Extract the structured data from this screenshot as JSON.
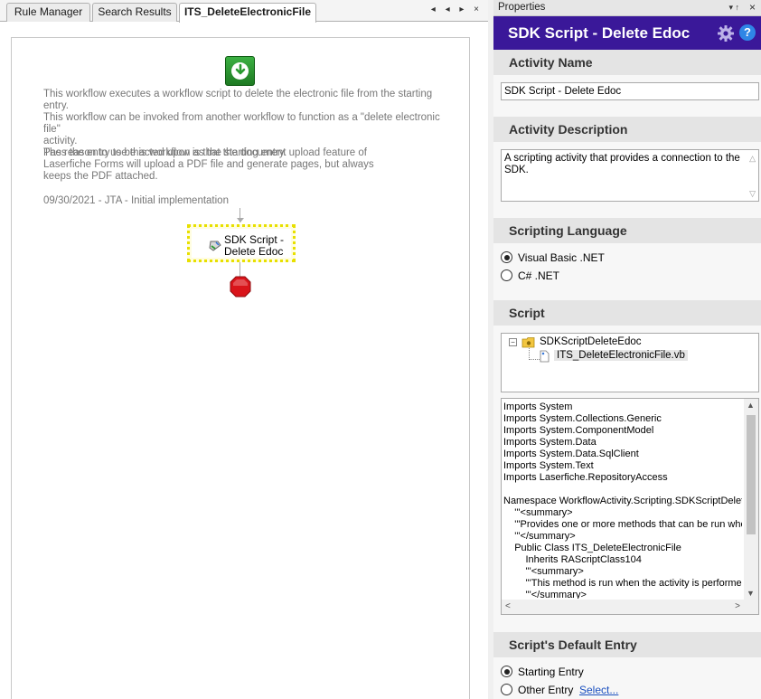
{
  "tabs": [
    {
      "label": "Rule Manager",
      "active": false
    },
    {
      "label": "Search Results",
      "active": false
    },
    {
      "label": "ITS_DeleteElectronicFile",
      "active": true
    }
  ],
  "tab_controls": "◂ ◂ ▸ ×",
  "workflow": {
    "description_1": "This workflow executes a workflow script to delete the electronic file from the starting entry.\nThis workflow can be invoked from another workflow to function as a \"delete electronic file\"\nactivity.\nPass the entry to be acted upon as the starting entry.",
    "description_2": "The reason to use this workflow is that the document upload feature of\nLaserfiche Forms will upload a PDF file and generate pages, but always\nkeeps the PDF attached.",
    "description_3": "09/30/2021 - JTA - Initial implementation",
    "activity_label": "SDK Script -\nDelete Edoc"
  },
  "properties": {
    "panel_title": "Properties",
    "pin_glyph": "▾ ↑",
    "close_glyph": "×",
    "heading": "SDK Script - Delete Edoc",
    "help_glyph": "?",
    "activity_name": {
      "header": "Activity Name",
      "value": "SDK Script - Delete Edoc"
    },
    "activity_description": {
      "header": "Activity Description",
      "value": "A scripting activity that provides a connection to the SDK."
    },
    "scripting_language": {
      "header": "Scripting Language",
      "options": [
        {
          "label": "Visual Basic .NET",
          "selected": true
        },
        {
          "label": "C# .NET",
          "selected": false
        }
      ]
    },
    "script": {
      "header": "Script",
      "tree_root": "SDKScriptDeleteEdoc",
      "tree_child": "ITS_DeleteElectronicFile.vb",
      "code_lines": [
        "Imports System",
        "Imports System.Collections.Generic",
        "Imports System.ComponentModel",
        "Imports System.Data",
        "Imports System.Data.SqlClient",
        "Imports System.Text",
        "Imports Laserfiche.RepositoryAccess",
        "",
        "Namespace WorkflowActivity.Scripting.SDKScriptDeleteEdoc",
        "    '''<summary>",
        "    '''Provides one or more methods that can be run when",
        "    '''</summary>",
        "    Public Class ITS_DeleteElectronicFile",
        "        Inherits RAScriptClass104",
        "        '''<summary>",
        "        '''This method is run when the activity is performed.",
        "        '''</summary>"
      ]
    },
    "default_entry": {
      "header": "Script's Default Entry",
      "options": [
        {
          "label": "Starting Entry",
          "selected": true
        },
        {
          "label": "Other Entry",
          "selected": false
        }
      ],
      "select_link": "Select..."
    }
  },
  "colors": {
    "header_purple": "#3a1899",
    "start_green": "#2e9d35",
    "stop_red": "#d9141a",
    "selection_yellow": "#e8e000"
  },
  "icons": [
    "start-icon",
    "activity-script-icon",
    "stop-icon",
    "gear-icon",
    "help-icon",
    "folder-icon",
    "file-icon"
  ]
}
